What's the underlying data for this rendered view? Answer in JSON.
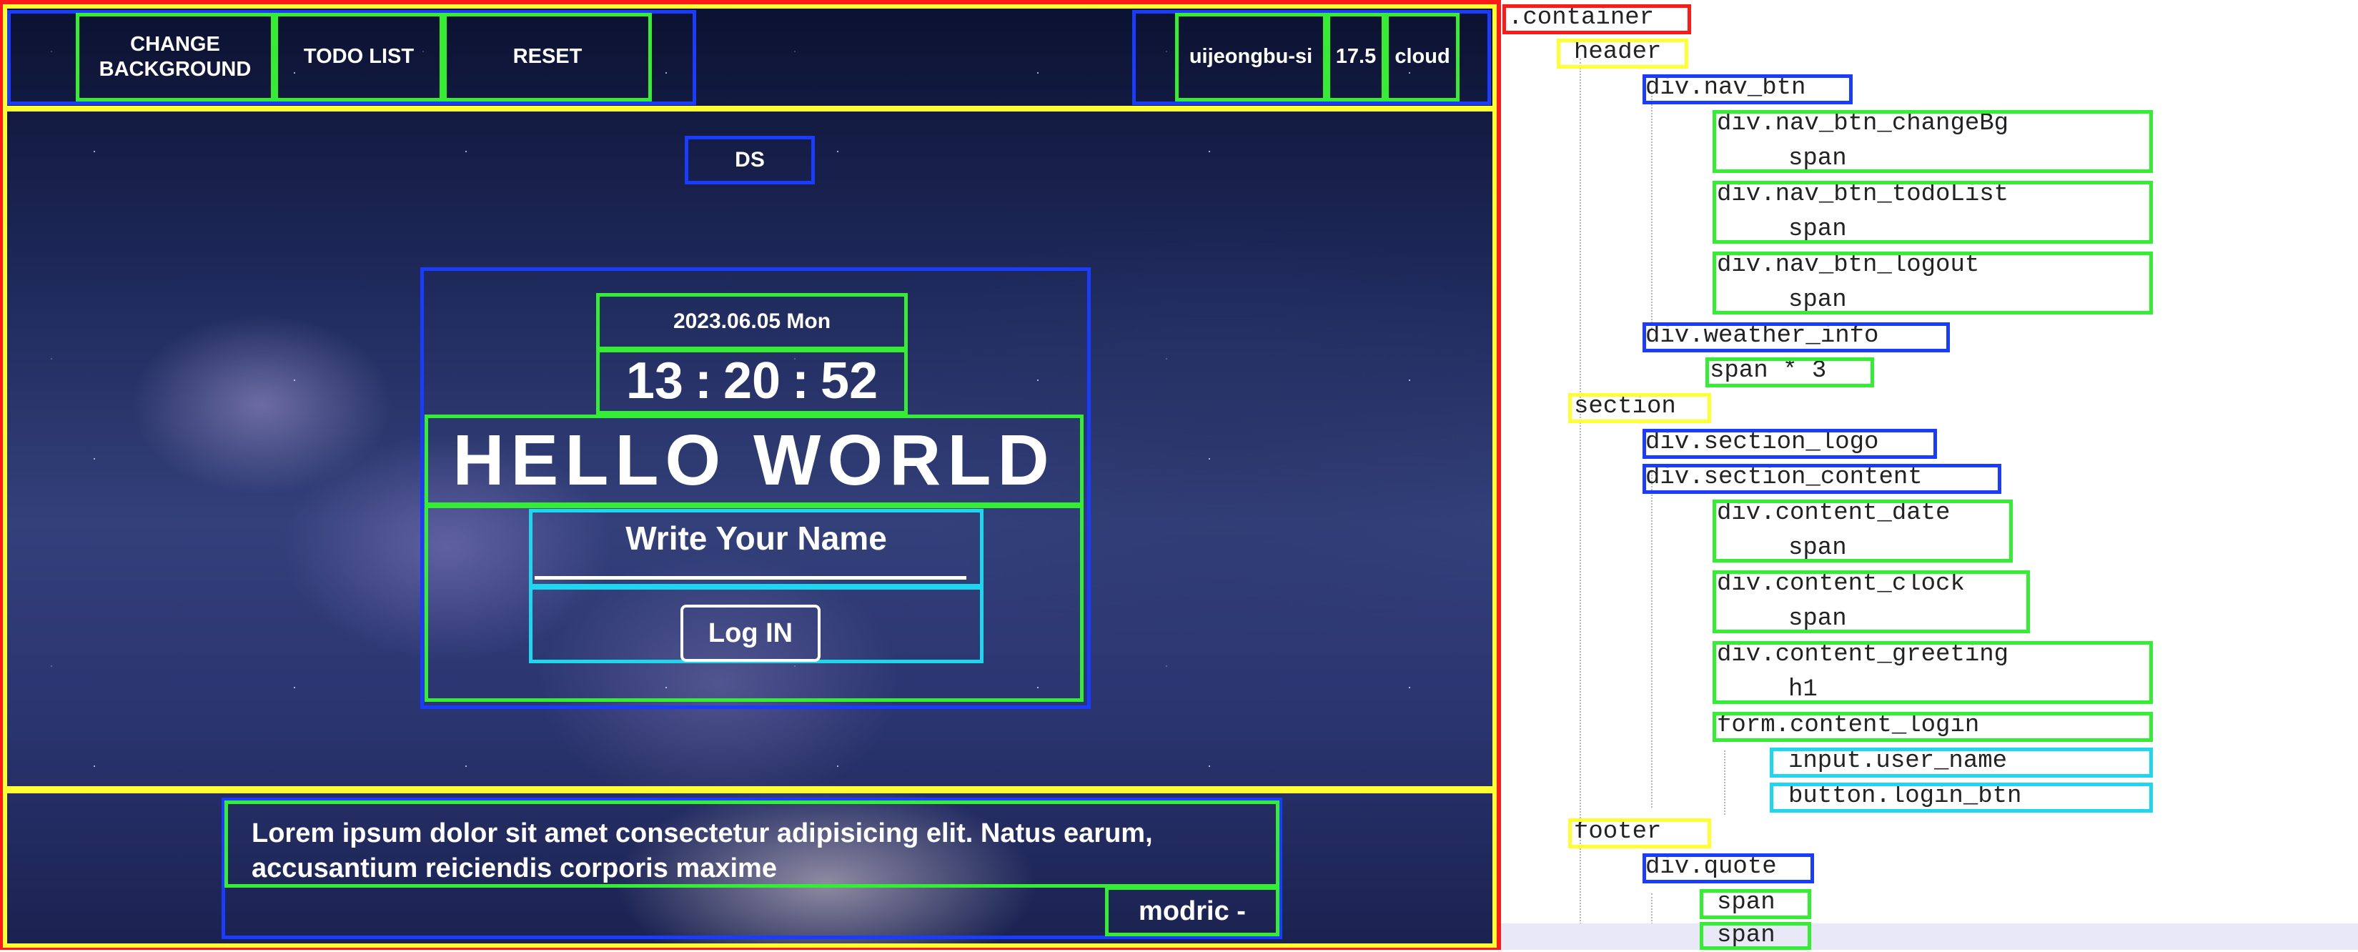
{
  "nav": {
    "change_bg": "CHANGE\nBACKGROUND",
    "todo_list": "TODO LIST",
    "reset": "RESET"
  },
  "weather": {
    "city": "uijeongbu-si",
    "temp": "17.5",
    "condition": "cloud"
  },
  "section": {
    "logo": "DS",
    "date": "2023.06.05 Mon",
    "clock": {
      "hh": "13",
      "sep1": ":",
      "mm": "20",
      "sep2": ":",
      "ss": "52"
    },
    "greeting": "HELLO WORLD",
    "name_placeholder": "Write Your Name",
    "login_label": "Log IN"
  },
  "footer": {
    "quote": "Lorem ipsum dolor sit amet consectetur adipisicing elit. Natus earum,\naccusantium reiciendis corporis maxime",
    "author": "modric -"
  },
  "tree": [
    ".container",
    "header",
    "div.nav_btn",
    "div.nav_btn_changeBg",
    "span",
    "div.nav_btn_todoList",
    "span",
    "div.nav_btn_logout",
    "span",
    "div.weather_info",
    "span * 3",
    "section",
    "div.section_logo",
    "div.section_content",
    "div.content_date",
    "span",
    "div.content_clock",
    "span",
    "div.content_greeting",
    "h1",
    "form.content_login",
    "input.user_name",
    "button.login_btn",
    "footer",
    "div.quote",
    "span",
    "span"
  ],
  "colors": {
    "container": "#ff1a1a",
    "level1": "#ffff33",
    "level2": "#1a3cff",
    "level3": "#33ee33",
    "level4": "#1ed7ee"
  }
}
